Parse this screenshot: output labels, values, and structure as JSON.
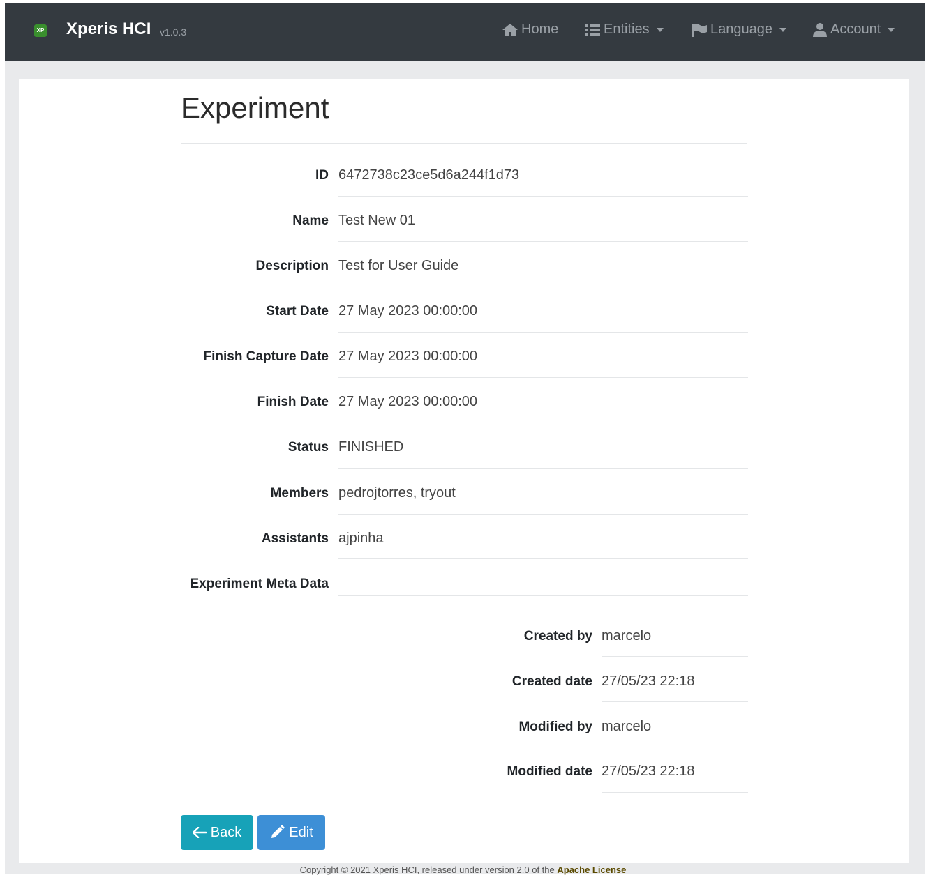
{
  "navbar": {
    "logo_text": "XP",
    "brand": "Xperis HCI",
    "version": "v1.0.3",
    "home_label": "Home",
    "entities_label": "Entities",
    "language_label": "Language",
    "account_label": "Account"
  },
  "page": {
    "title": "Experiment"
  },
  "details": [
    {
      "label": "ID",
      "value": "6472738c23ce5d6a244f1d73"
    },
    {
      "label": "Name",
      "value": "Test New 01"
    },
    {
      "label": "Description",
      "value": "Test for User Guide"
    },
    {
      "label": "Start Date",
      "value": "27 May 2023 00:00:00"
    },
    {
      "label": "Finish Capture Date",
      "value": "27 May 2023 00:00:00"
    },
    {
      "label": "Finish Date",
      "value": "27 May 2023 00:00:00"
    },
    {
      "label": "Status",
      "value": "FINISHED"
    },
    {
      "label": "Members",
      "value": "pedrojtorres, tryout"
    },
    {
      "label": "Assistants",
      "value": "ajpinha"
    },
    {
      "label": "Experiment Meta Data",
      "value": ""
    }
  ],
  "audit": [
    {
      "label": "Created by",
      "value": "marcelo"
    },
    {
      "label": "Created date",
      "value": "27/05/23 22:18"
    },
    {
      "label": "Modified by",
      "value": "marcelo"
    },
    {
      "label": "Modified date",
      "value": "27/05/23 22:18"
    }
  ],
  "actions": {
    "back_label": "Back",
    "edit_label": "Edit"
  },
  "footer": {
    "text": "Copyright © 2021 Xperis HCI, released under version 2.0 of the ",
    "link": "Apache License"
  },
  "colors": {
    "navbar_bg": "#343a40",
    "back_button": "#17a2b8",
    "edit_button": "#3d8fd6"
  }
}
